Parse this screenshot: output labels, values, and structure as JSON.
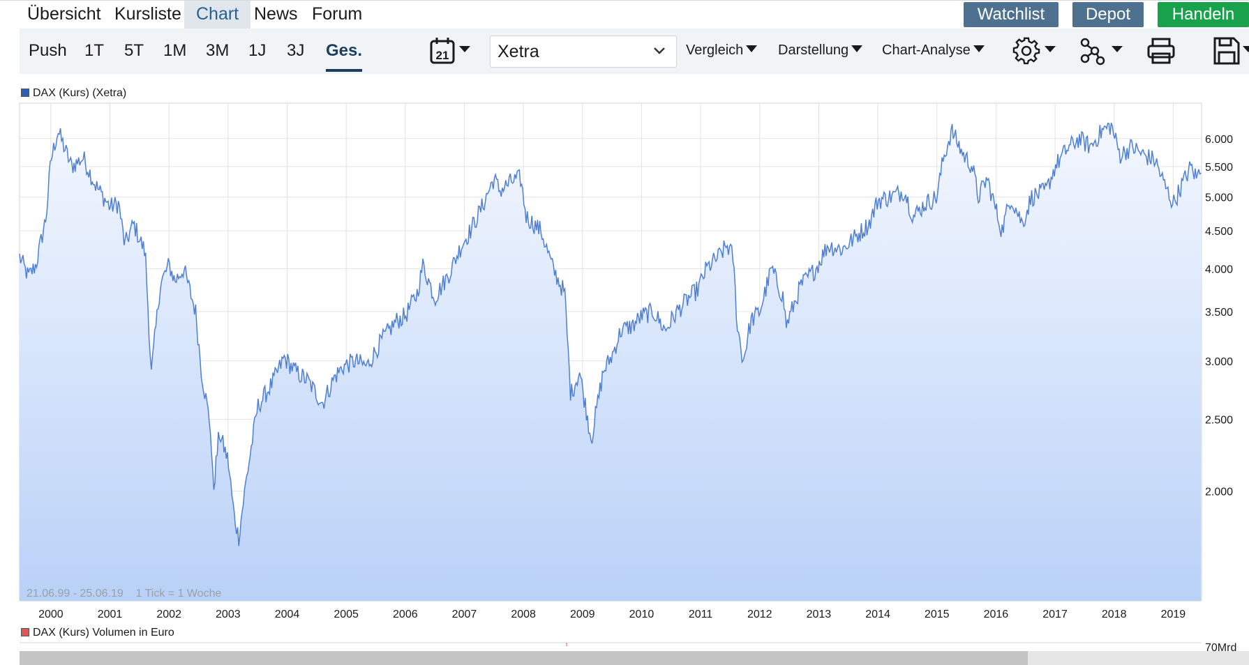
{
  "nav": {
    "tabs": [
      {
        "label": "Übersicht"
      },
      {
        "label": "Kursliste"
      },
      {
        "label": "Chart"
      },
      {
        "label": "News"
      },
      {
        "label": "Forum"
      }
    ],
    "active_tab": "Chart",
    "buttons": [
      {
        "label": "Watchlist",
        "color": "#4f7190"
      },
      {
        "label": "Depot",
        "color": "#4f7190"
      },
      {
        "label": "Handeln",
        "color": "#18a24b"
      }
    ]
  },
  "toolbar": {
    "ranges": [
      "Push",
      "1T",
      "5T",
      "1M",
      "3M",
      "1J",
      "3J",
      "Ges."
    ],
    "active_range": "Ges.",
    "calendar_day": "21",
    "exchange": "Xetra",
    "menus": [
      "Vergleich",
      "Darstellung",
      "Chart-Analyse"
    ],
    "icons": [
      "calendar-icon",
      "gear-icon",
      "network-icon",
      "print-icon",
      "save-icon"
    ]
  },
  "chart": {
    "legend_price": "DAX (Kurs) (Xetra)",
    "legend_price_color": "#2c5fb4",
    "legend_volume": "DAX (Kurs) Volumen in Euro",
    "legend_volume_color": "#d9595b",
    "info": "21.06.99 - 25.06.19    1 Tick = 1 Woche",
    "volume_axis_label": "70Mrd"
  },
  "chart_data": {
    "type": "area",
    "scale": "log",
    "line_color": "#4f7fd3",
    "fill_top_color": "#f3f7fe",
    "fill_bottom_color": "#b9d1f7",
    "x_range": [
      1999.47,
      2019.48
    ],
    "ylim": [
      1420,
      6700
    ],
    "yticks": [
      2000,
      2500,
      3000,
      3500,
      4000,
      4500,
      5000,
      5500,
      6000
    ],
    "ytick_labels": [
      "2.000",
      "2.500",
      "3.000",
      "3.500",
      "4.000",
      "4.500",
      "5.000",
      "5.500",
      "6.000"
    ],
    "xtick_years": [
      2000,
      2001,
      2002,
      2003,
      2004,
      2005,
      2006,
      2007,
      2008,
      2009,
      2010,
      2011,
      2012,
      2013,
      2014,
      2015,
      2016,
      2017,
      2018,
      2019
    ],
    "grid": true,
    "anchors": [
      [
        1999.47,
        4150
      ],
      [
        1999.62,
        3900
      ],
      [
        1999.75,
        4050
      ],
      [
        1999.92,
        4700
      ],
      [
        2000.0,
        5600
      ],
      [
        2000.12,
        6150
      ],
      [
        2000.35,
        5500
      ],
      [
        2000.55,
        5650
      ],
      [
        2000.75,
        5200
      ],
      [
        2001.0,
        4850
      ],
      [
        2001.15,
        4900
      ],
      [
        2001.25,
        4300
      ],
      [
        2001.4,
        4600
      ],
      [
        2001.6,
        4200
      ],
      [
        2001.7,
        2880
      ],
      [
        2001.85,
        3800
      ],
      [
        2002.0,
        4050
      ],
      [
        2002.1,
        3850
      ],
      [
        2002.25,
        4000
      ],
      [
        2002.45,
        3500
      ],
      [
        2002.55,
        2900
      ],
      [
        2002.7,
        2450
      ],
      [
        2002.75,
        2000
      ],
      [
        2002.85,
        2400
      ],
      [
        2003.0,
        2200
      ],
      [
        2003.1,
        1860
      ],
      [
        2003.18,
        1730
      ],
      [
        2003.3,
        2050
      ],
      [
        2003.5,
        2600
      ],
      [
        2003.75,
        2800
      ],
      [
        2003.95,
        3030
      ],
      [
        2004.15,
        2900
      ],
      [
        2004.35,
        2820
      ],
      [
        2004.6,
        2630
      ],
      [
        2004.8,
        2850
      ],
      [
        2004.95,
        2950
      ],
      [
        2005.15,
        3000
      ],
      [
        2005.35,
        2950
      ],
      [
        2005.6,
        3200
      ],
      [
        2005.85,
        3400
      ],
      [
        2006.0,
        3450
      ],
      [
        2006.2,
        3700
      ],
      [
        2006.3,
        4050
      ],
      [
        2006.5,
        3650
      ],
      [
        2006.75,
        3950
      ],
      [
        2006.95,
        4300
      ],
      [
        2007.1,
        4500
      ],
      [
        2007.3,
        4850
      ],
      [
        2007.5,
        5300
      ],
      [
        2007.6,
        5100
      ],
      [
        2007.8,
        5250
      ],
      [
        2007.95,
        5300
      ],
      [
        2008.05,
        4700
      ],
      [
        2008.3,
        4500
      ],
      [
        2008.5,
        4000
      ],
      [
        2008.7,
        3700
      ],
      [
        2008.8,
        2700
      ],
      [
        2008.95,
        2900
      ],
      [
        2009.15,
        2350
      ],
      [
        2009.35,
        2900
      ],
      [
        2009.5,
        3050
      ],
      [
        2009.65,
        3300
      ],
      [
        2009.85,
        3350
      ],
      [
        2010.0,
        3450
      ],
      [
        2010.2,
        3500
      ],
      [
        2010.4,
        3300
      ],
      [
        2010.6,
        3500
      ],
      [
        2010.8,
        3650
      ],
      [
        2010.95,
        3750
      ],
      [
        2011.1,
        4000
      ],
      [
        2011.3,
        4150
      ],
      [
        2011.45,
        4300
      ],
      [
        2011.55,
        4150
      ],
      [
        2011.62,
        3350
      ],
      [
        2011.72,
        3000
      ],
      [
        2011.85,
        3400
      ],
      [
        2012.0,
        3500
      ],
      [
        2012.2,
        4000
      ],
      [
        2012.4,
        3650
      ],
      [
        2012.45,
        3350
      ],
      [
        2012.7,
        3800
      ],
      [
        2012.95,
        4000
      ],
      [
        2013.15,
        4300
      ],
      [
        2013.4,
        4250
      ],
      [
        2013.6,
        4400
      ],
      [
        2013.85,
        4600
      ],
      [
        2014.0,
        4950
      ],
      [
        2014.2,
        5000
      ],
      [
        2014.45,
        5100
      ],
      [
        2014.6,
        4700
      ],
      [
        2014.8,
        4900
      ],
      [
        2015.0,
        5000
      ],
      [
        2015.1,
        5600
      ],
      [
        2015.25,
        6150
      ],
      [
        2015.45,
        5700
      ],
      [
        2015.6,
        5500
      ],
      [
        2015.7,
        5000
      ],
      [
        2015.85,
        5300
      ],
      [
        2016.0,
        4800
      ],
      [
        2016.1,
        4500
      ],
      [
        2016.25,
        5000
      ],
      [
        2016.45,
        4600
      ],
      [
        2016.6,
        5000
      ],
      [
        2016.85,
        5100
      ],
      [
        2017.0,
        5500
      ],
      [
        2017.2,
        5800
      ],
      [
        2017.4,
        6000
      ],
      [
        2017.6,
        5850
      ],
      [
        2017.8,
        6150
      ],
      [
        2017.95,
        6250
      ],
      [
        2018.1,
        5700
      ],
      [
        2018.3,
        5850
      ],
      [
        2018.5,
        5700
      ],
      [
        2018.7,
        5600
      ],
      [
        2018.85,
        5200
      ],
      [
        2019.0,
        4900
      ],
      [
        2019.15,
        5200
      ],
      [
        2019.3,
        5500
      ],
      [
        2019.4,
        5300
      ],
      [
        2019.48,
        5550
      ]
    ]
  }
}
